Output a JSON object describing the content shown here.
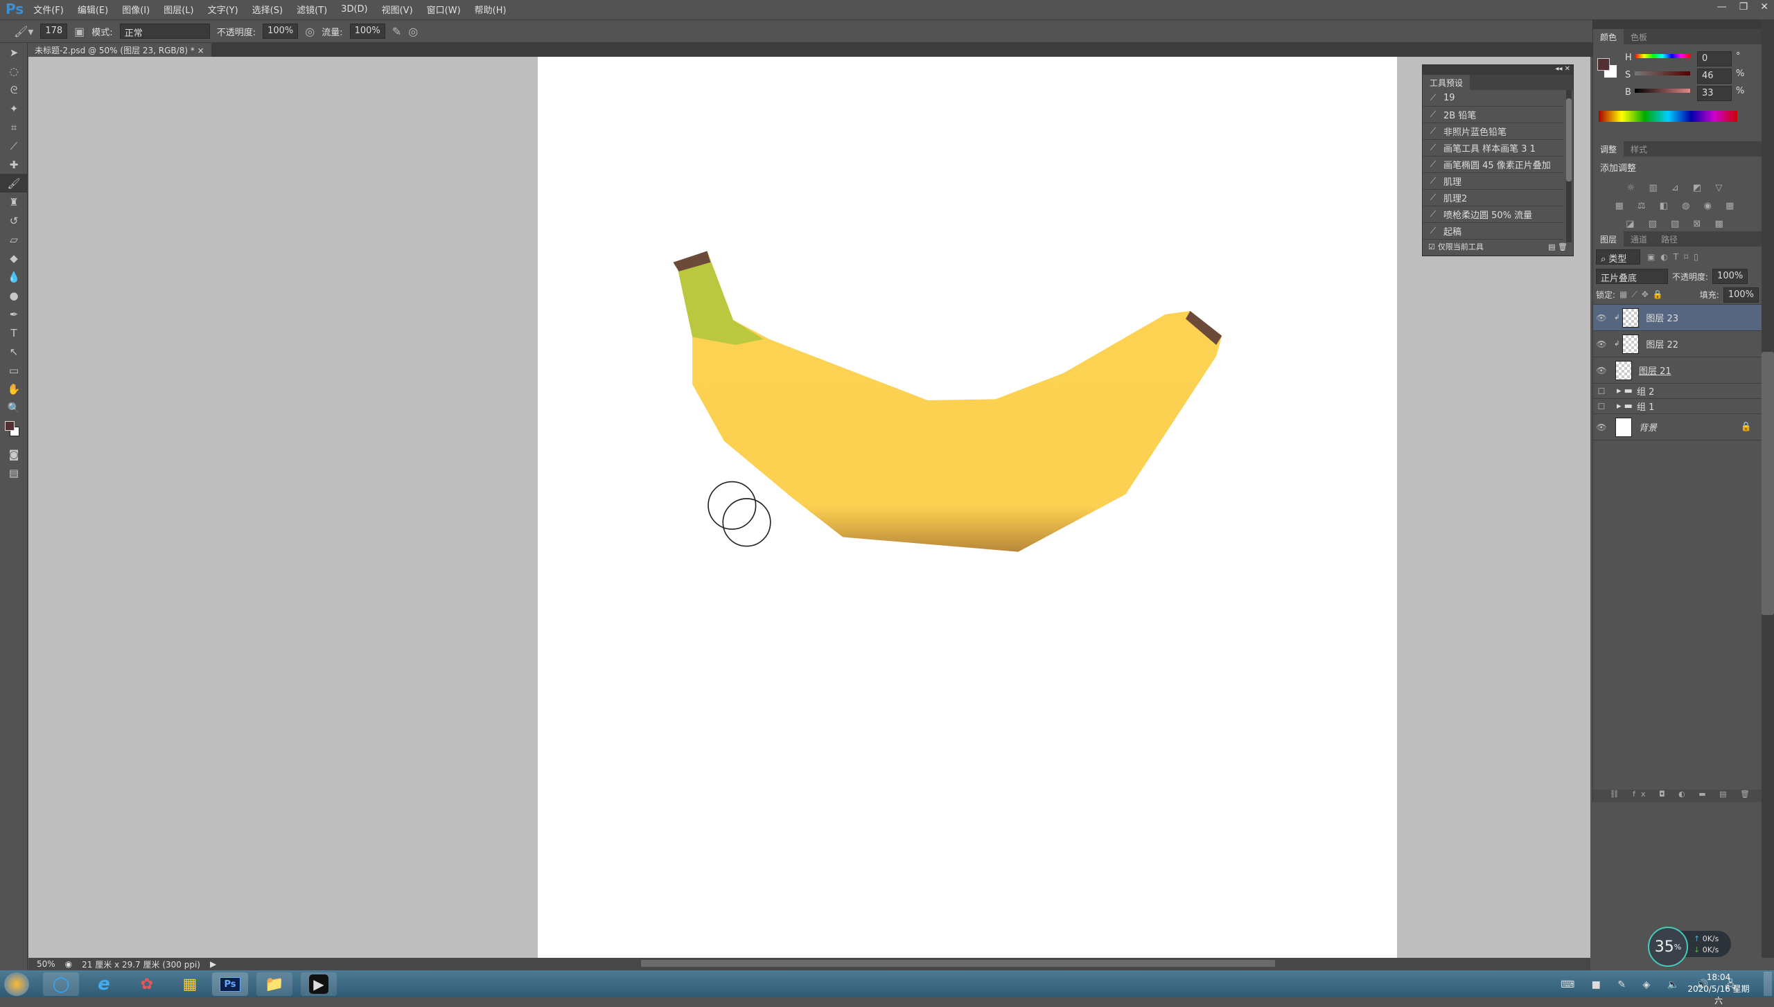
{
  "app": {
    "logo": "Ps",
    "menu": [
      "文件(F)",
      "编辑(E)",
      "图像(I)",
      "图层(L)",
      "文字(Y)",
      "选择(S)",
      "滤镜(T)",
      "3D(D)",
      "视图(V)",
      "窗口(W)",
      "帮助(H)"
    ]
  },
  "options": {
    "brush_size": "178",
    "mode_label": "模式:",
    "mode_value": "正常",
    "opacity_label": "不透明度:",
    "opacity_value": "100%",
    "flow_label": "流量:",
    "flow_value": "100%"
  },
  "document": {
    "tab_title": "未标题-2.psd @ 50% (图层 23, RGB/8) *",
    "close": "×"
  },
  "status": {
    "zoom": "50%",
    "doc_size": "21 厘米 x 29.7 厘米 (300 ppi)"
  },
  "tool_presets": {
    "title": "工具预设",
    "items": [
      "19",
      "2B 铅笔",
      "非照片蓝色铅笔",
      "画笔工具 样本画笔 3 1",
      "画笔椭圆 45 像素正片叠加",
      "肌理",
      "肌理2",
      "喷枪柔边圆 50% 流量",
      "起稿"
    ],
    "current_only": "仅限当前工具"
  },
  "color_panel": {
    "tabs": [
      "颜色",
      "色板"
    ],
    "h_label": "H",
    "h": "0",
    "h_unit": "°",
    "s_label": "S",
    "s": "46",
    "s_unit": "%",
    "b_label": "B",
    "b": "33",
    "b_unit": "%",
    "foreground": "#542f31",
    "background": "#ffffff"
  },
  "adjust_panel": {
    "tabs": [
      "调整",
      "样式"
    ],
    "heading": "添加调整"
  },
  "layers_panel": {
    "tabs": [
      "图层",
      "通道",
      "路径"
    ],
    "filter": "类型",
    "blend": "正片叠底",
    "opacity_label": "不透明度:",
    "opacity": "100%",
    "lock_label": "锁定:",
    "fill_label": "填充:",
    "fill": "100%",
    "layers": [
      {
        "name": "图层 23",
        "selected": true
      },
      {
        "name": "图层 22"
      },
      {
        "name": "图层 21"
      },
      {
        "name": "组 2"
      },
      {
        "name": "组 1"
      },
      {
        "name": "背景"
      }
    ]
  },
  "widget": {
    "cpu": "35",
    "cpu_unit": "%",
    "up": "0",
    "down": "0",
    "rate_unit": "K/s"
  },
  "taskbar": {
    "ps_label": "Ps",
    "time": "18:04",
    "date": "2020/5/16 星期六"
  }
}
